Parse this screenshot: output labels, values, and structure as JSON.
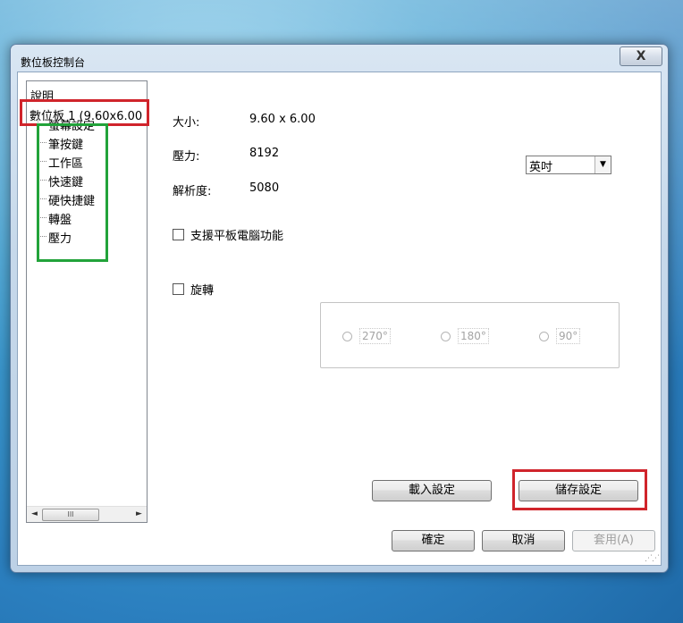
{
  "window": {
    "title": "數位板控制台",
    "close_label": "X"
  },
  "tree": {
    "help": "說明",
    "tablet": "數位板 1 (9.60x6.00",
    "children": [
      "螢幕設定",
      "筆按鍵",
      "工作區",
      "快速鍵",
      "硬快捷鍵",
      "轉盤",
      "壓力"
    ],
    "scroll_left": "◄",
    "scroll_thumb": "III",
    "scroll_right": "►"
  },
  "info": {
    "size_label": "大小:",
    "size_value": "9.60 x 6.00",
    "pressure_label": "壓力:",
    "pressure_value": "8192",
    "resolution_label": "解析度:",
    "resolution_value": "5080"
  },
  "units": {
    "selected": "英吋",
    "arrow": "▼"
  },
  "options": {
    "tablet_pc_label": "支援平板電腦功能",
    "rotate_label": "旋轉",
    "rotations": [
      "270°",
      "180°",
      "90°"
    ]
  },
  "buttons": {
    "load": "載入設定",
    "save": "儲存設定",
    "ok": "確定",
    "cancel": "取消",
    "apply": "套用(A)"
  },
  "colors": {
    "highlight_red": "#d0242b",
    "highlight_green": "#22a33a"
  }
}
